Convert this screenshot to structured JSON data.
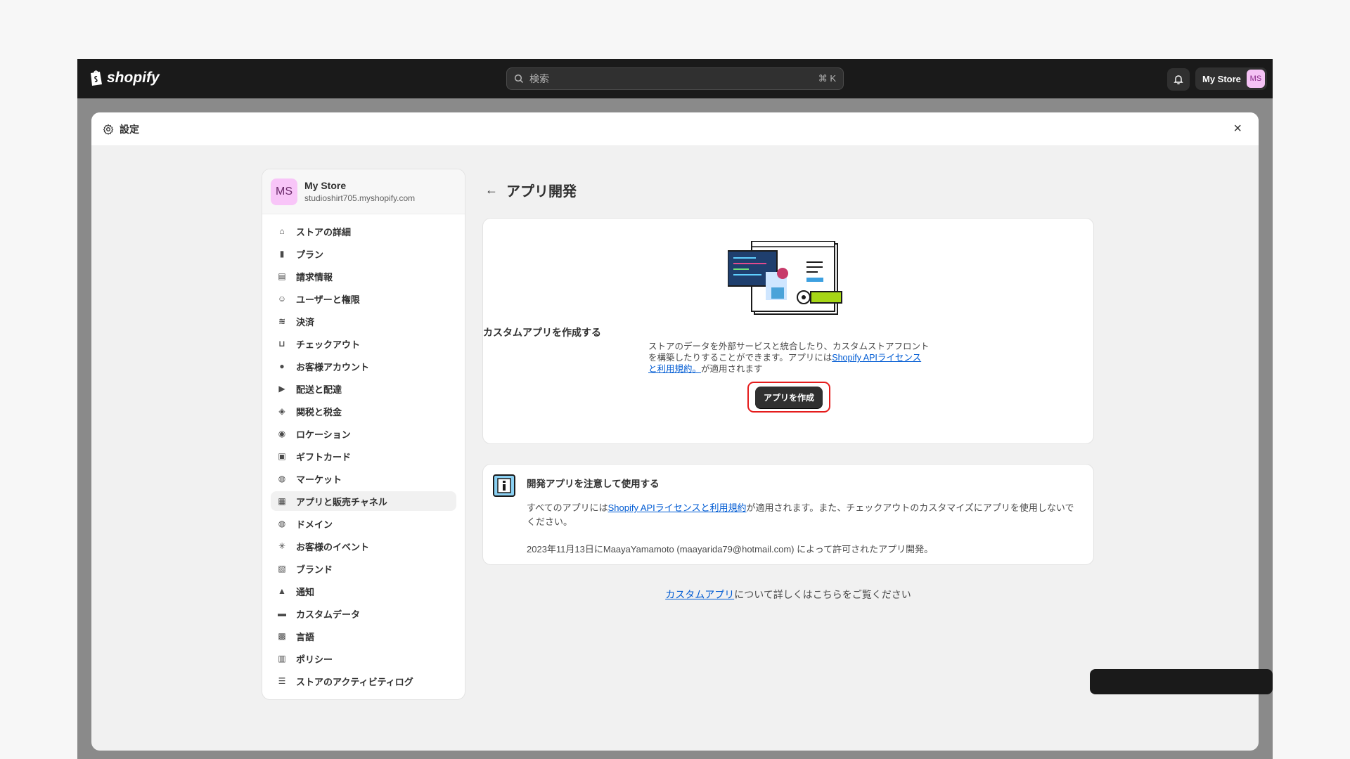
{
  "topbar": {
    "brand": "shopify",
    "search_placeholder": "検索",
    "search_shortcut": "⌘ K",
    "store_button_label": "My Store",
    "avatar_initials": "MS"
  },
  "modal": {
    "title": "設定",
    "close_label": "×"
  },
  "sidebar": {
    "store_name": "My Store",
    "store_domain": "studioshirt705.myshopify.com",
    "avatar_initials": "MS",
    "items": [
      {
        "label": "ストアの詳細",
        "icon": "store-icon"
      },
      {
        "label": "プラン",
        "icon": "plan-icon"
      },
      {
        "label": "請求情報",
        "icon": "billing-icon"
      },
      {
        "label": "ユーザーと権限",
        "icon": "users-icon"
      },
      {
        "label": "決済",
        "icon": "payments-icon"
      },
      {
        "label": "チェックアウト",
        "icon": "cart-icon"
      },
      {
        "label": "お客様アカウント",
        "icon": "person-icon"
      },
      {
        "label": "配送と配達",
        "icon": "truck-icon"
      },
      {
        "label": "関税と税金",
        "icon": "tax-icon"
      },
      {
        "label": "ロケーション",
        "icon": "location-icon"
      },
      {
        "label": "ギフトカード",
        "icon": "gift-card-icon"
      },
      {
        "label": "マーケット",
        "icon": "globe-icon"
      },
      {
        "label": "アプリと販売チャネル",
        "icon": "apps-icon"
      },
      {
        "label": "ドメイン",
        "icon": "domain-icon"
      },
      {
        "label": "お客様のイベント",
        "icon": "events-icon"
      },
      {
        "label": "ブランド",
        "icon": "brand-icon"
      },
      {
        "label": "通知",
        "icon": "bell-icon"
      },
      {
        "label": "カスタムデータ",
        "icon": "data-icon"
      },
      {
        "label": "言語",
        "icon": "language-icon"
      },
      {
        "label": "ポリシー",
        "icon": "policy-icon"
      },
      {
        "label": "ストアのアクティビティログ",
        "icon": "list-icon"
      }
    ],
    "active_index": 12
  },
  "main": {
    "page_title": "アプリ開発",
    "hero": {
      "title": "カスタムアプリを作成する",
      "desc_part1": "ストアのデータを外部サービスと統合したり、カスタムストアフロントを構築したりすることができます。アプリには",
      "desc_link": "Shopify APIライセンスと利用規約。",
      "desc_part2": "が適用されます",
      "button_label": "アプリを作成"
    },
    "notice": {
      "title": "開発アプリを注意して使用する",
      "text_part1": "すべてのアプリには",
      "text_link": "Shopify APIライセンスと利用規約",
      "text_part2": "が適用されます。また、チェックアウトのカスタマイズにアプリを使用しないでください。",
      "meta": "2023年11月13日にMaayaYamamoto (maayarida79@hotmail.com) によって許可されたアプリ開発。"
    },
    "footer_link": "カスタムアプリ",
    "footer_text": "について詳しくはこちらをご覧ください"
  },
  "colors": {
    "topbar": "#1a1a1a",
    "accent_link": "#005bd3",
    "highlight_border": "#e51c1c",
    "primary_button": "#303030"
  }
}
